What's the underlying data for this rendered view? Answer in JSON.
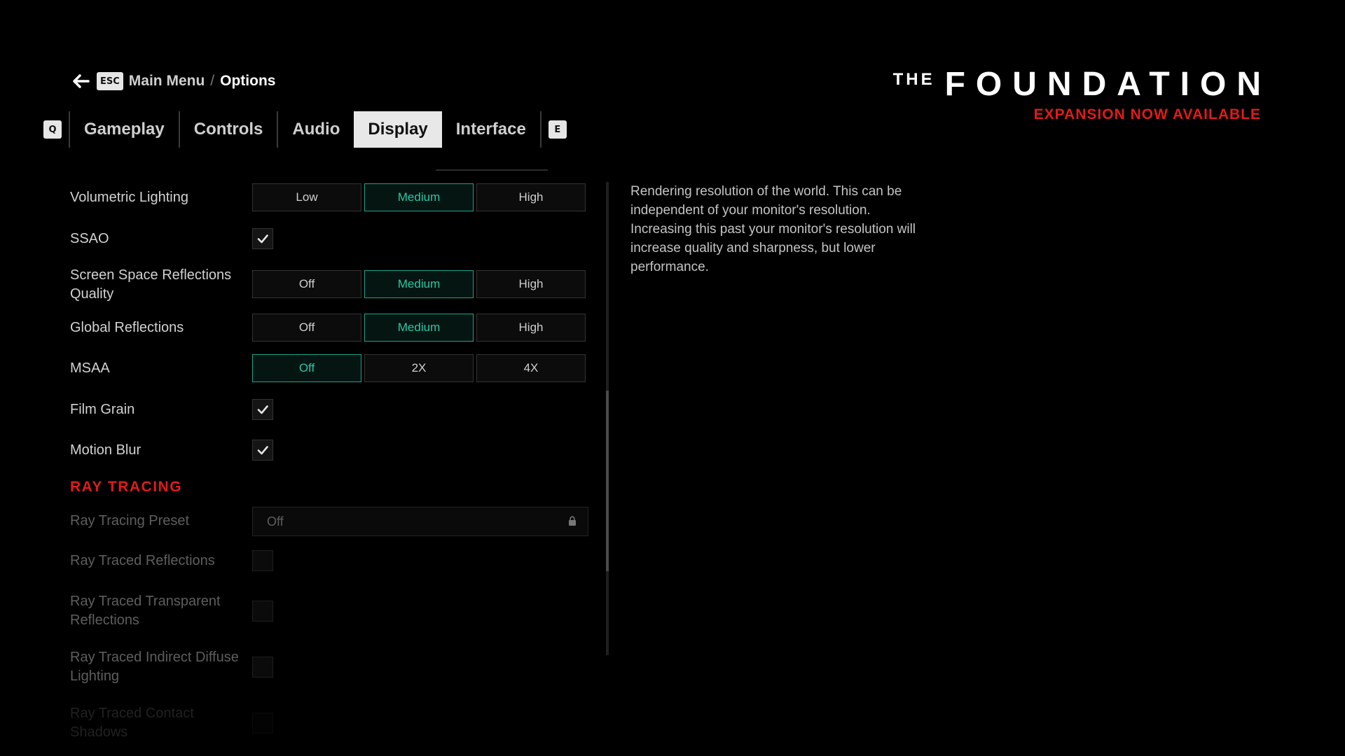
{
  "breadcrumb": {
    "esc_key": "ESC",
    "parent": "Main Menu",
    "separator": "/",
    "current": "Options"
  },
  "tabs": {
    "prev_key": "Q",
    "next_key": "E",
    "items": [
      {
        "label": "Gameplay",
        "active": false
      },
      {
        "label": "Controls",
        "active": false
      },
      {
        "label": "Audio",
        "active": false
      },
      {
        "label": "Display",
        "active": true
      },
      {
        "label": "Interface",
        "active": false
      }
    ]
  },
  "logo": {
    "the": "THE",
    "title": "FOUNDATION",
    "subtitle": "EXPANSION NOW AVAILABLE",
    "accent_color": "#e01b1b"
  },
  "settings": {
    "volumetric_lighting": {
      "label": "Volumetric Lighting",
      "options": [
        "Low",
        "Medium",
        "High"
      ],
      "selected": "Medium"
    },
    "ssao": {
      "label": "SSAO",
      "checked": true
    },
    "ssr_quality": {
      "label": "Screen Space Reflections Quality",
      "options": [
        "Off",
        "Medium",
        "High"
      ],
      "selected": "Medium"
    },
    "global_reflections": {
      "label": "Global Reflections",
      "options": [
        "Off",
        "Medium",
        "High"
      ],
      "selected": "Medium"
    },
    "msaa": {
      "label": "MSAA",
      "options": [
        "Off",
        "2X",
        "4X"
      ],
      "selected": "Off"
    },
    "film_grain": {
      "label": "Film Grain",
      "checked": true
    },
    "motion_blur": {
      "label": "Motion Blur",
      "checked": true
    },
    "ray_tracing": {
      "section_title": "RAY TRACING",
      "preset": {
        "label": "Ray Tracing Preset",
        "value": "Off",
        "locked": true
      },
      "reflections": {
        "label": "Ray Traced Reflections",
        "checked": false
      },
      "transparent_reflections": {
        "label": "Ray Traced Transparent Reflections",
        "checked": false
      },
      "indirect_diffuse": {
        "label": "Ray Traced Indirect Diffuse Lighting",
        "checked": false
      },
      "contact_shadows": {
        "label": "Ray Traced Contact Shadows",
        "checked": false
      }
    }
  },
  "description": "Rendering resolution of the world. This can be independent of your monitor's resolution. Increasing this past your monitor's resolution will increase quality and sharpness, but lower performance.",
  "colors": {
    "selected": "#27c9a8",
    "section": "#e01b1b"
  },
  "icons": {
    "back": "arrow-left-icon",
    "check": "checkmark-icon",
    "lock": "lock-icon"
  }
}
